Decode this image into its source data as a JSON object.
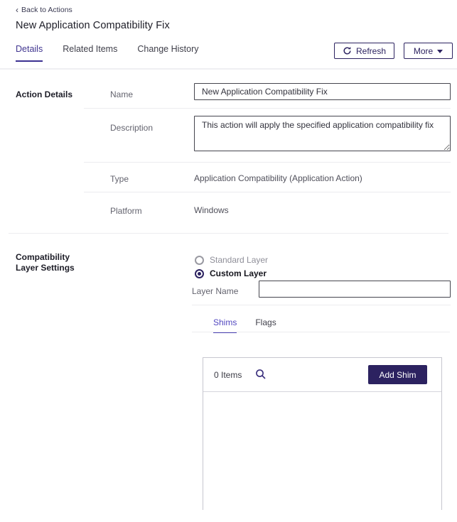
{
  "header": {
    "back_link": "Back to Actions",
    "title": "New Application Compatibility Fix",
    "tabs": [
      {
        "label": "Details",
        "active": true
      },
      {
        "label": "Related Items",
        "active": false
      },
      {
        "label": "Change History",
        "active": false
      }
    ],
    "refresh_button": "Refresh",
    "more_button": "More"
  },
  "action_details": {
    "section_title": "Action Details",
    "fields": {
      "name": {
        "label": "Name",
        "value": "New Application Compatibility Fix"
      },
      "description": {
        "label": "Description",
        "value": "This action will apply the specified application compatibility fix"
      },
      "type": {
        "label": "Type",
        "value": "Application Compatibility (Application Action)"
      },
      "platform": {
        "label": "Platform",
        "value": "Windows"
      }
    }
  },
  "compatibility_layer_settings": {
    "section_title_line1": "Compatibility",
    "section_title_line2": "Layer Settings",
    "radio_options": [
      {
        "label": "Standard Layer",
        "selected": false
      },
      {
        "label": "Custom Layer",
        "selected": true
      }
    ],
    "selected_option": "Custom Layer",
    "layer_name": {
      "label": "Layer Name",
      "value": ""
    },
    "tabs": [
      {
        "label": "Shims",
        "active": true
      },
      {
        "label": "Flags",
        "active": false
      }
    ],
    "shims_panel": {
      "items_count": "0 Items",
      "add_button": "Add Shim"
    }
  },
  "colors": {
    "accent_dark_purple": "#2c2260",
    "active_tab_purple": "#4c42b4",
    "details_tab_purple": "#413690",
    "label_gray": "#63636e",
    "disabled_gray": "#8f8f99",
    "divider_gray": "#ececef",
    "panel_border_gray": "#c7c7cf"
  }
}
